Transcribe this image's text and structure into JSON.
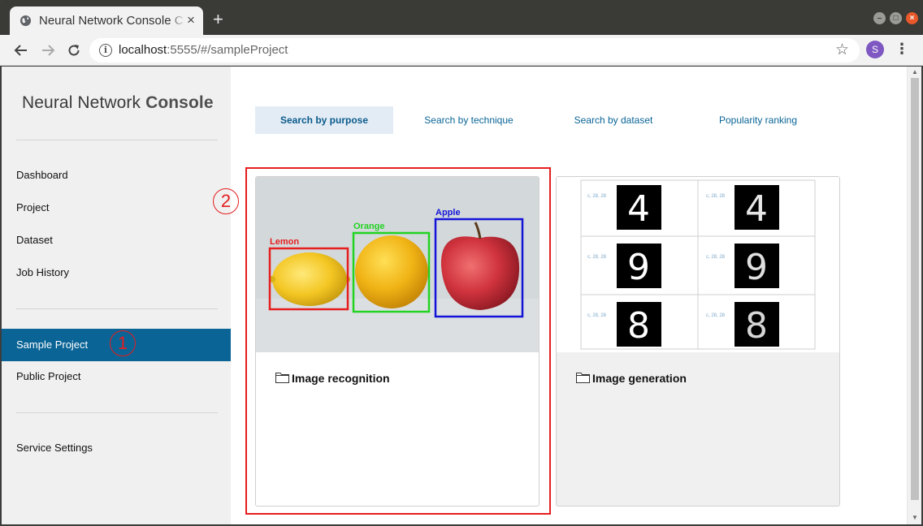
{
  "browser": {
    "tab_title": "Neural Network Console C",
    "tab_close": "×",
    "new_tab": "+",
    "window_buttons": {
      "minimize": "–",
      "maximize": "□",
      "close": "×"
    },
    "url_host": "localhost",
    "url_path": ":5555/#/sampleProject",
    "avatar_letter": "S"
  },
  "sidebar": {
    "logo_light": "Neural Network",
    "logo_bold": "Console",
    "items_group1": [
      {
        "label": "Dashboard"
      },
      {
        "label": "Project"
      },
      {
        "label": "Dataset"
      },
      {
        "label": "Job History"
      }
    ],
    "items_group2": [
      {
        "label": "Sample Project",
        "active": true
      },
      {
        "label": "Public Project"
      }
    ],
    "items_group3": [
      {
        "label": "Service Settings"
      }
    ]
  },
  "annotations": {
    "one": "1",
    "two": "2"
  },
  "search_tabs": [
    {
      "label": "Search by purpose",
      "active": true
    },
    {
      "label": "Search by technique"
    },
    {
      "label": "Search by dataset"
    },
    {
      "label": "Popularity ranking"
    }
  ],
  "cards": [
    {
      "title": "Image recognition",
      "labels": {
        "lemon": "Lemon",
        "orange": "Orange",
        "apple": "Apple"
      }
    },
    {
      "title": "Image generation",
      "digit_labels": [
        "c, 28, 28",
        "c, 28, 28",
        "c, 28, 28",
        "c, 28, 28",
        "c, 28, 28",
        "c, 28, 28"
      ],
      "digits": [
        "4",
        "4",
        "9",
        "9",
        "8",
        "8"
      ]
    }
  ],
  "colors": {
    "accent": "#0a6496",
    "annotation_red": "#e51e1e",
    "lemon_box": "#e51e1e",
    "orange_box": "#22d322",
    "apple_box": "#1414d8"
  }
}
